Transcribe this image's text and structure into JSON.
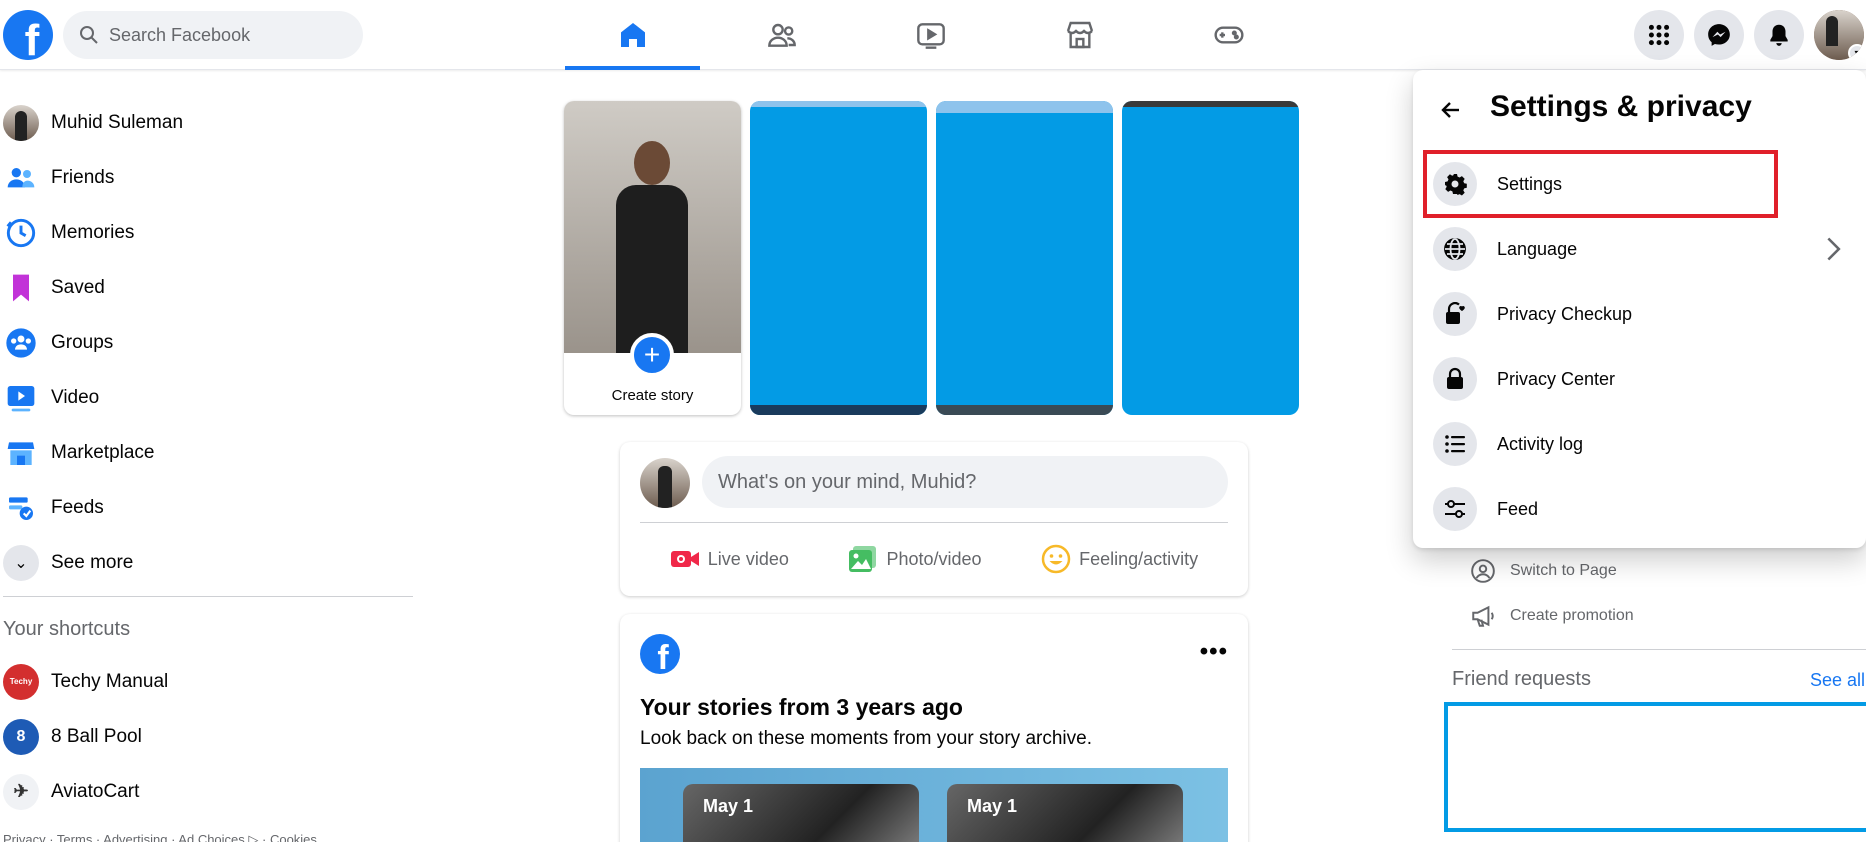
{
  "header": {
    "logo_letter": "f",
    "search_placeholder": "Search Facebook",
    "nav_tabs": [
      {
        "name": "home",
        "active": true
      },
      {
        "name": "friends",
        "active": false
      },
      {
        "name": "watch",
        "active": false
      },
      {
        "name": "marketplace",
        "active": false
      },
      {
        "name": "gaming",
        "active": false
      }
    ],
    "right_buttons": [
      "menu-grid-icon",
      "messenger-icon",
      "notifications-icon",
      "account-avatar"
    ],
    "accent_color": "#1877f2"
  },
  "sidebar": {
    "items": [
      {
        "label": "Muhid Suleman",
        "icon": "profile-avatar"
      },
      {
        "label": "Friends",
        "icon": "friends-icon"
      },
      {
        "label": "Memories",
        "icon": "memories-icon"
      },
      {
        "label": "Saved",
        "icon": "saved-icon"
      },
      {
        "label": "Groups",
        "icon": "groups-icon"
      },
      {
        "label": "Video",
        "icon": "video-icon"
      },
      {
        "label": "Marketplace",
        "icon": "marketplace-icon"
      },
      {
        "label": "Feeds",
        "icon": "feeds-icon"
      },
      {
        "label": "See more",
        "icon": "chevron-down-icon"
      }
    ],
    "shortcuts_heading": "Your shortcuts",
    "shortcuts": [
      {
        "label": "Techy Manual",
        "badge": "Techy"
      },
      {
        "label": "8 Ball Pool",
        "badge": "8"
      },
      {
        "label": "AviatoCart",
        "badge": "✈"
      }
    ],
    "footer": "Privacy · Terms · Advertising · Ad Choices ▷ · Cookies"
  },
  "stories": {
    "create_label": "Create story",
    "plus": "+",
    "placeholder_color": "#039be5"
  },
  "composer": {
    "placeholder": "What's on your mind, Muhid?",
    "actions": [
      {
        "label": "Live video",
        "icon": "live-video-icon"
      },
      {
        "label": "Photo/video",
        "icon": "photo-video-icon"
      },
      {
        "label": "Feeling/activity",
        "icon": "feeling-icon"
      }
    ]
  },
  "memory_card": {
    "logo_letter": "f",
    "more": "•••",
    "title": "Your stories from 3 years ago",
    "subtitle": "Look back on these moments from your story archive.",
    "thumbs": [
      "May 1",
      "May 1"
    ]
  },
  "right_column": {
    "switch_to_page": "Switch to Page",
    "create_promotion": "Create promotion",
    "friend_requests": "Friend requests",
    "see_all": "See all"
  },
  "settings_popup": {
    "title": "Settings & privacy",
    "items": [
      {
        "label": "Settings",
        "icon": "gear-icon",
        "highlighted": true
      },
      {
        "label": "Language",
        "icon": "globe-icon",
        "has_chevron": true
      },
      {
        "label": "Privacy Checkup",
        "icon": "lock-heart-icon"
      },
      {
        "label": "Privacy Center",
        "icon": "lock-icon"
      },
      {
        "label": "Activity log",
        "icon": "list-icon"
      },
      {
        "label": "Feed",
        "icon": "sliders-icon"
      }
    ],
    "highlight_color": "#e0202a"
  }
}
